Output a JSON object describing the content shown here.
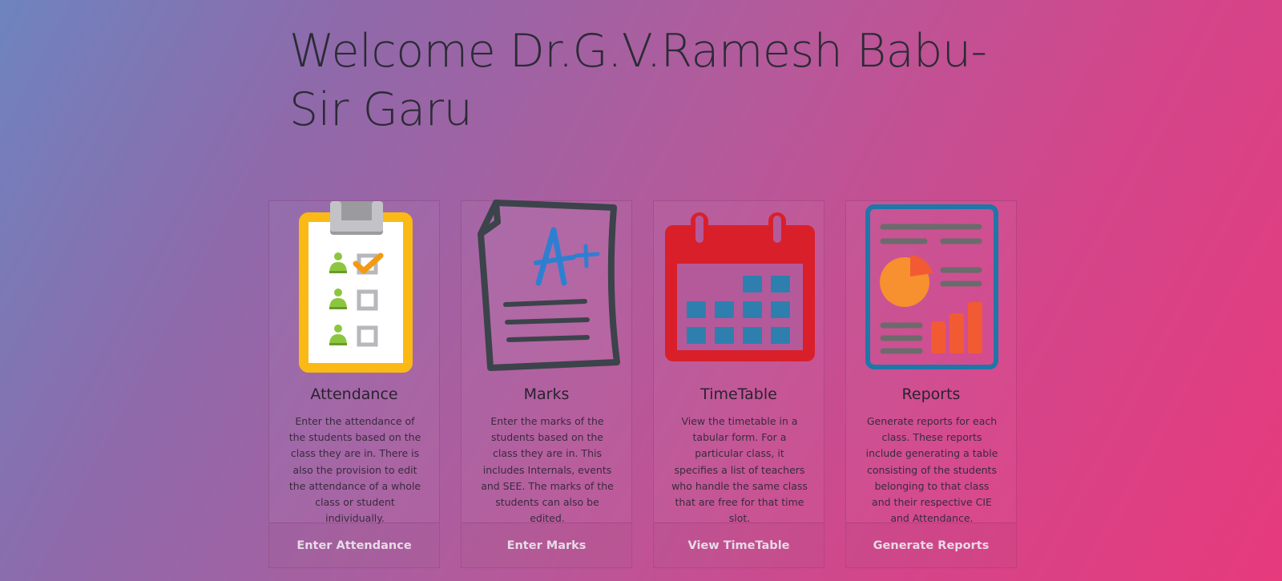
{
  "header": {
    "welcome": "Welcome Dr.G.V.Ramesh Babu-Sir Garu"
  },
  "cards": [
    {
      "icon": "attendance-clipboard-icon",
      "title": "Attendance",
      "text": "Enter the attendance of the students based on the class they are in. There is also the provision to edit the attendance of a whole class or student individually.",
      "link": "Enter Attendance"
    },
    {
      "icon": "marks-paper-icon",
      "title": "Marks",
      "text": "Enter the marks of the students based on the class they are in. This includes Internals, events and SEE. The marks of the students can also be edited.",
      "link": "Enter Marks"
    },
    {
      "icon": "calendar-icon",
      "title": "TimeTable",
      "text": "View the timetable in a tabular form. For a particular class, it specifies a list of teachers who handle the same class that are free for that time slot.",
      "link": "View TimeTable"
    },
    {
      "icon": "report-chart-icon",
      "title": "Reports",
      "text": "Generate reports for each class. These reports include generating a table consisting of the students belonging to that class and their respective CIE and Attendance.",
      "link": "Generate Reports"
    }
  ],
  "colors": {
    "gradient_start": "#6e84bf",
    "gradient_end": "#e63a7c",
    "card_link": "#e6dbe6",
    "clipboard_yellow": "#fbb915",
    "marks_blue": "#2f7fd1",
    "calendar_red": "#d9202a",
    "report_blue": "#1f77a8"
  }
}
